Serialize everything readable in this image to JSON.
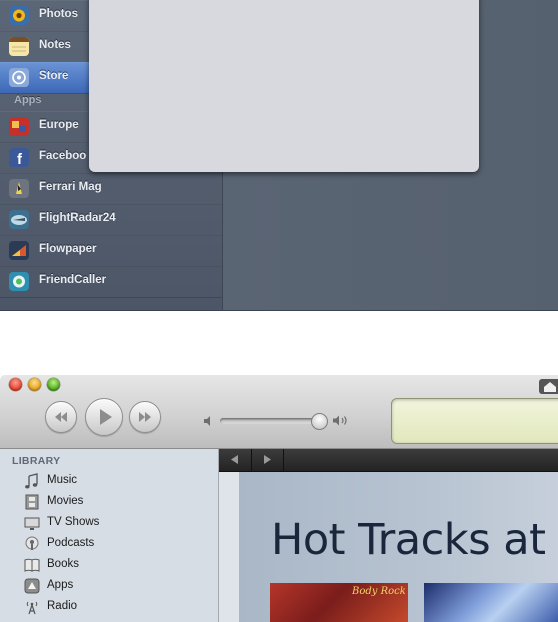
{
  "ipad_settings": {
    "rows": [
      {
        "label": "Photos",
        "icon": "sunflower-icon"
      },
      {
        "label": "Notes",
        "icon": "notes-icon"
      },
      {
        "label": "Store",
        "icon": "store-icon",
        "selected": true
      },
      {
        "label": "Europe",
        "icon": "europe-app-icon"
      },
      {
        "label": "Faceboo",
        "icon": "facebook-icon"
      },
      {
        "label": "Ferrari Mag",
        "icon": "ferrari-icon"
      },
      {
        "label": "FlightRadar24",
        "icon": "flightradar-icon"
      },
      {
        "label": "Flowpaper",
        "icon": "flowpaper-icon"
      },
      {
        "label": "FriendCaller",
        "icon": "friendcaller-icon"
      }
    ],
    "section_header": "Apps",
    "colors": {
      "selected": "#4a74c0",
      "sidebar": "#556070",
      "popover": "#d7d9df"
    }
  },
  "itunes": {
    "toolbar": {
      "prev_icon": "rewind-icon",
      "play_icon": "play-icon",
      "next_icon": "fast-forward-icon",
      "volume_level": 0.88
    },
    "library": {
      "title": "LIBRARY",
      "items": [
        {
          "label": "Music",
          "icon": "music-note-icon"
        },
        {
          "label": "Movies",
          "icon": "film-icon"
        },
        {
          "label": "TV Shows",
          "icon": "tv-icon"
        },
        {
          "label": "Podcasts",
          "icon": "podcast-icon"
        },
        {
          "label": "Books",
          "icon": "book-icon"
        },
        {
          "label": "Apps",
          "icon": "apps-icon"
        },
        {
          "label": "Radio",
          "icon": "radio-antenna-icon"
        }
      ]
    },
    "store": {
      "hero_title": "Hot Tracks at",
      "album_1_script": "Body Rock"
    }
  }
}
